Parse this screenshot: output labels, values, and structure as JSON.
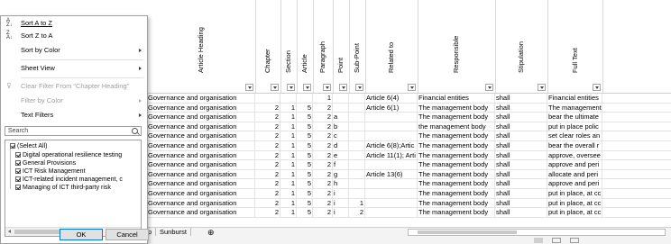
{
  "columns": [
    {
      "key": "heading",
      "label": "Article Heading"
    },
    {
      "key": "chapter",
      "label": "Chapter"
    },
    {
      "key": "section",
      "label": "Section"
    },
    {
      "key": "article",
      "label": "Article"
    },
    {
      "key": "paragraph",
      "label": "Paragraph"
    },
    {
      "key": "point",
      "label": "Point"
    },
    {
      "key": "subpoint",
      "label": "Sub-Point"
    },
    {
      "key": "related",
      "label": "Related to"
    },
    {
      "key": "responsible",
      "label": "Responsible"
    },
    {
      "key": "stipulation",
      "label": "Stipulation"
    },
    {
      "key": "fulltext",
      "label": "Full Text"
    }
  ],
  "rows": [
    [
      "Governance and organisation",
      "",
      "",
      "",
      "1",
      "",
      "",
      "Article 6(4)",
      "Financial entities",
      "shall",
      "Financial entities"
    ],
    [
      "Governance and organisation",
      "2",
      "1",
      "5",
      "2",
      "",
      "",
      "Article 6(1)",
      "The management body",
      "shall",
      "The management"
    ],
    [
      "Governance and organisation",
      "2",
      "1",
      "5",
      "2",
      "a",
      "",
      "",
      "The management body",
      "shall",
      "bear the ultimate"
    ],
    [
      "Governance and organisation",
      "2",
      "1",
      "5",
      "2",
      "b",
      "",
      "",
      "the management body",
      "shall",
      "put in place polic"
    ],
    [
      "Governance and organisation",
      "2",
      "1",
      "5",
      "2",
      "c",
      "",
      "",
      "The management body",
      "shall",
      "set clear roles an"
    ],
    [
      "Governance and organisation",
      "2",
      "1",
      "5",
      "2",
      "d",
      "",
      "Article 6(8);Artic",
      "The management body",
      "shall",
      "bear the overall r"
    ],
    [
      "Governance and organisation",
      "2",
      "1",
      "5",
      "2",
      "e",
      "",
      "Article 11(1); Arti",
      "The management body",
      "shall",
      "approve, oversee"
    ],
    [
      "Governance and organisation",
      "2",
      "1",
      "5",
      "2",
      "f",
      "",
      "",
      "The management body",
      "shall",
      "approve and peri"
    ],
    [
      "Governance and organisation",
      "2",
      "1",
      "5",
      "2",
      "g",
      "",
      "Article 13(6)",
      "The management body",
      "shall",
      "allocate and peri"
    ],
    [
      "Governance and organisation",
      "2",
      "1",
      "5",
      "2",
      "h",
      "",
      "",
      "The management body",
      "shall",
      "approve and peri"
    ],
    [
      "Governance and organisation",
      "2",
      "1",
      "5",
      "2",
      "i",
      "",
      "",
      "The management body",
      "shall",
      "put in place, at cc"
    ],
    [
      "Governance and organisation",
      "2",
      "1",
      "5",
      "2",
      "i",
      "1",
      "",
      "The management body",
      "shall",
      "put in place, at cc"
    ],
    [
      "Governance and organisation",
      "2",
      "1",
      "5",
      "2",
      "i",
      "2",
      "",
      "The management body",
      "shall",
      "put in place, at cc"
    ]
  ],
  "sheet_tabs": {
    "partial": "p",
    "sunburst": "Sunburst",
    "add": "⊕"
  },
  "menu": {
    "sort_az": "Sort A to Z",
    "sort_za": "Sort Z to A",
    "sort_color": "Sort by Color",
    "sheet_view": "Sheet View",
    "clear_filter": "Clear Filter From \"Chapter Heading\"",
    "filter_color": "Filter by Color",
    "text_filters": "Text Filters"
  },
  "search": {
    "placeholder": "Search"
  },
  "filter_items": [
    "(Select All)",
    "Digital operational resilience testing",
    "General Provisions",
    "ICT Risk Management",
    "ICT-related incident management, c",
    "Managing of ICT third-party risk"
  ],
  "buttons": {
    "ok": "OK",
    "cancel": "Cancel"
  }
}
